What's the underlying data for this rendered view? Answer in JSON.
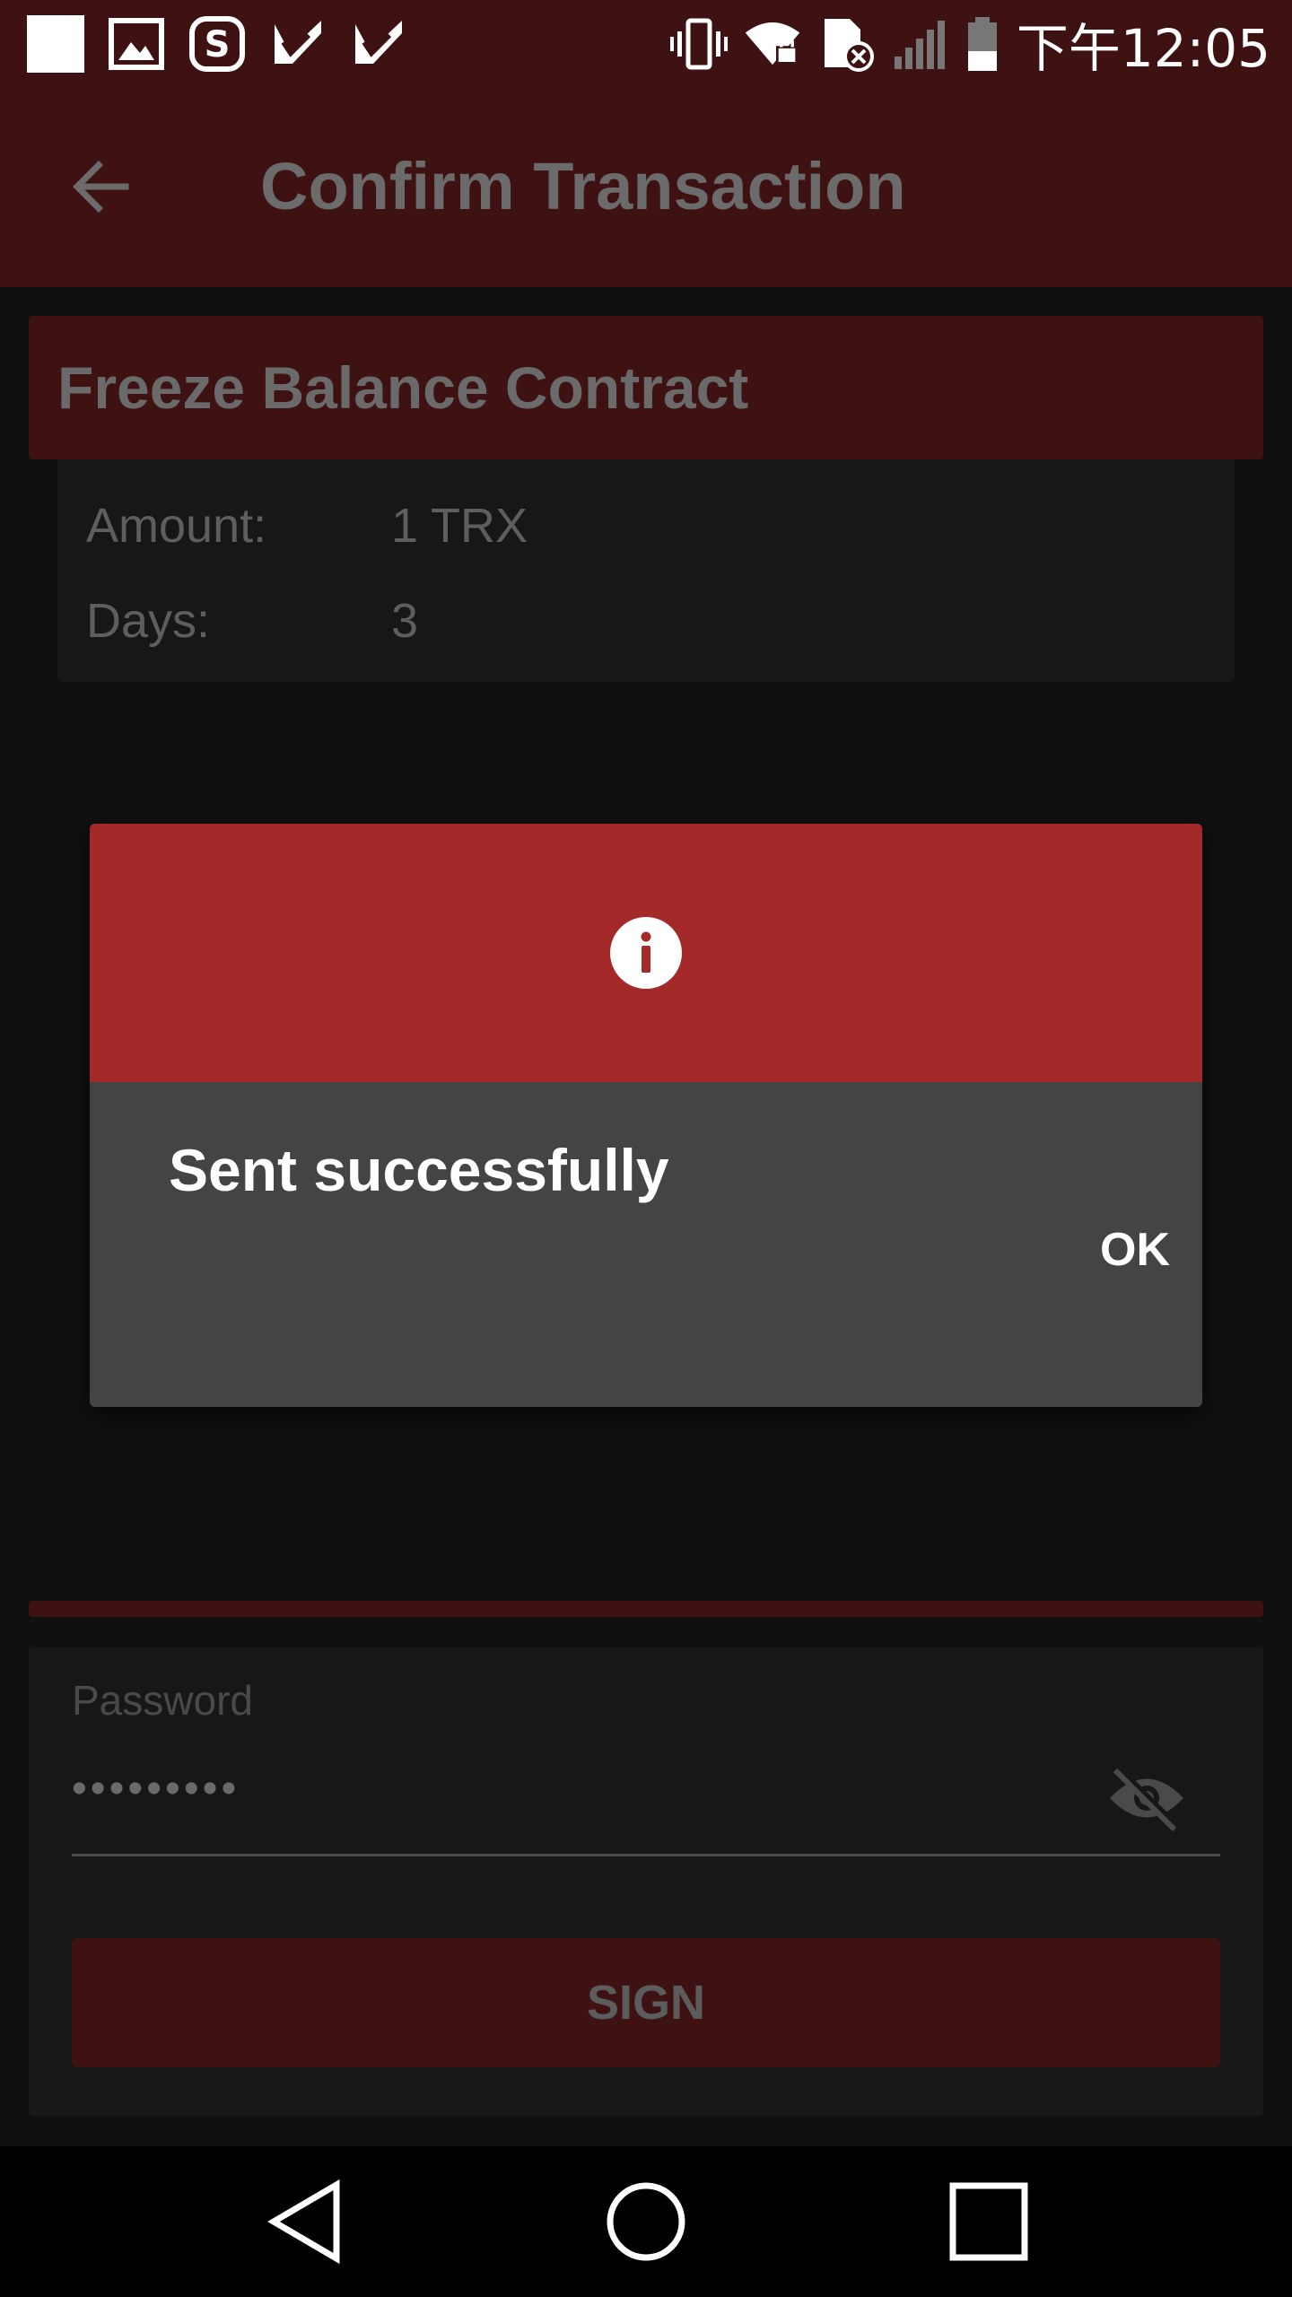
{
  "status_bar": {
    "time": "下午12:05",
    "left_icons": [
      "square-notification-icon",
      "gallery-icon",
      "sogou-icon",
      "check-app-icon",
      "check-app-icon"
    ],
    "right_icons": [
      "vibrate-icon",
      "wifi-locked-icon",
      "sim-error-icon",
      "signal-icon",
      "battery-icon"
    ]
  },
  "toolbar": {
    "title": "Confirm Transaction",
    "back_icon": "arrow-back-icon"
  },
  "contract": {
    "title": "Freeze Balance Contract",
    "rows": [
      {
        "label": "Amount:",
        "value": "1 TRX"
      },
      {
        "label": "Days:",
        "value": "3"
      }
    ]
  },
  "password": {
    "label": "Password",
    "value": "•••••••••",
    "toggle_icon": "eye-off-icon"
  },
  "sign_button": {
    "label": "SIGN"
  },
  "dialog": {
    "icon": "info-icon",
    "message": "Sent successfully",
    "ok_label": "OK"
  },
  "nav_bar": {
    "back_icon": "nav-back-icon",
    "home_icon": "nav-home-icon",
    "recents_icon": "nav-recents-icon"
  },
  "colors": {
    "toolbar_bg": "#3e1112",
    "dialog_header": "#a32a29",
    "dialog_body": "#444444",
    "background": "#101010"
  }
}
